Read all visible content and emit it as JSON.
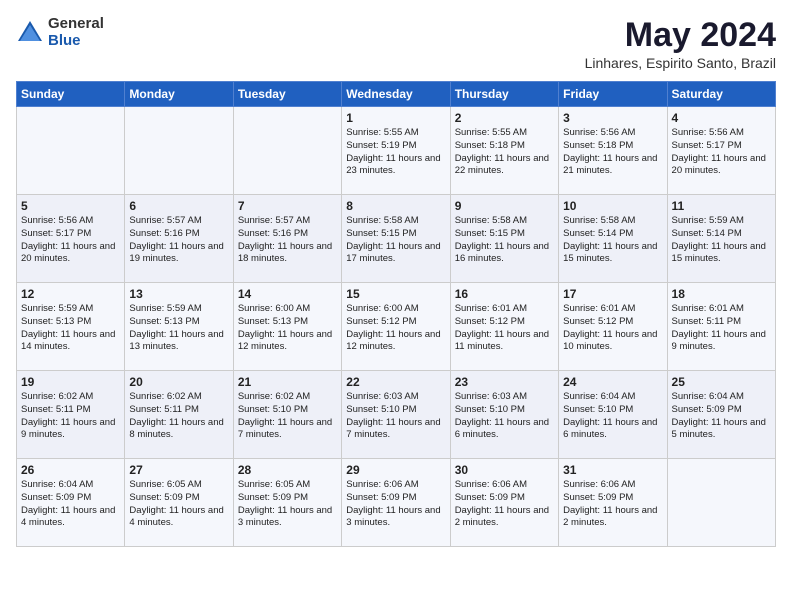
{
  "logo": {
    "general": "General",
    "blue": "Blue"
  },
  "title": "May 2024",
  "subtitle": "Linhares, Espirito Santo, Brazil",
  "days_of_week": [
    "Sunday",
    "Monday",
    "Tuesday",
    "Wednesday",
    "Thursday",
    "Friday",
    "Saturday"
  ],
  "weeks": [
    [
      {
        "day": "",
        "sunrise": "",
        "sunset": "",
        "daylight": ""
      },
      {
        "day": "",
        "sunrise": "",
        "sunset": "",
        "daylight": ""
      },
      {
        "day": "",
        "sunrise": "",
        "sunset": "",
        "daylight": ""
      },
      {
        "day": "1",
        "sunrise": "Sunrise: 5:55 AM",
        "sunset": "Sunset: 5:19 PM",
        "daylight": "Daylight: 11 hours and 23 minutes."
      },
      {
        "day": "2",
        "sunrise": "Sunrise: 5:55 AM",
        "sunset": "Sunset: 5:18 PM",
        "daylight": "Daylight: 11 hours and 22 minutes."
      },
      {
        "day": "3",
        "sunrise": "Sunrise: 5:56 AM",
        "sunset": "Sunset: 5:18 PM",
        "daylight": "Daylight: 11 hours and 21 minutes."
      },
      {
        "day": "4",
        "sunrise": "Sunrise: 5:56 AM",
        "sunset": "Sunset: 5:17 PM",
        "daylight": "Daylight: 11 hours and 20 minutes."
      }
    ],
    [
      {
        "day": "5",
        "sunrise": "Sunrise: 5:56 AM",
        "sunset": "Sunset: 5:17 PM",
        "daylight": "Daylight: 11 hours and 20 minutes."
      },
      {
        "day": "6",
        "sunrise": "Sunrise: 5:57 AM",
        "sunset": "Sunset: 5:16 PM",
        "daylight": "Daylight: 11 hours and 19 minutes."
      },
      {
        "day": "7",
        "sunrise": "Sunrise: 5:57 AM",
        "sunset": "Sunset: 5:16 PM",
        "daylight": "Daylight: 11 hours and 18 minutes."
      },
      {
        "day": "8",
        "sunrise": "Sunrise: 5:58 AM",
        "sunset": "Sunset: 5:15 PM",
        "daylight": "Daylight: 11 hours and 17 minutes."
      },
      {
        "day": "9",
        "sunrise": "Sunrise: 5:58 AM",
        "sunset": "Sunset: 5:15 PM",
        "daylight": "Daylight: 11 hours and 16 minutes."
      },
      {
        "day": "10",
        "sunrise": "Sunrise: 5:58 AM",
        "sunset": "Sunset: 5:14 PM",
        "daylight": "Daylight: 11 hours and 15 minutes."
      },
      {
        "day": "11",
        "sunrise": "Sunrise: 5:59 AM",
        "sunset": "Sunset: 5:14 PM",
        "daylight": "Daylight: 11 hours and 15 minutes."
      }
    ],
    [
      {
        "day": "12",
        "sunrise": "Sunrise: 5:59 AM",
        "sunset": "Sunset: 5:13 PM",
        "daylight": "Daylight: 11 hours and 14 minutes."
      },
      {
        "day": "13",
        "sunrise": "Sunrise: 5:59 AM",
        "sunset": "Sunset: 5:13 PM",
        "daylight": "Daylight: 11 hours and 13 minutes."
      },
      {
        "day": "14",
        "sunrise": "Sunrise: 6:00 AM",
        "sunset": "Sunset: 5:13 PM",
        "daylight": "Daylight: 11 hours and 12 minutes."
      },
      {
        "day": "15",
        "sunrise": "Sunrise: 6:00 AM",
        "sunset": "Sunset: 5:12 PM",
        "daylight": "Daylight: 11 hours and 12 minutes."
      },
      {
        "day": "16",
        "sunrise": "Sunrise: 6:01 AM",
        "sunset": "Sunset: 5:12 PM",
        "daylight": "Daylight: 11 hours and 11 minutes."
      },
      {
        "day": "17",
        "sunrise": "Sunrise: 6:01 AM",
        "sunset": "Sunset: 5:12 PM",
        "daylight": "Daylight: 11 hours and 10 minutes."
      },
      {
        "day": "18",
        "sunrise": "Sunrise: 6:01 AM",
        "sunset": "Sunset: 5:11 PM",
        "daylight": "Daylight: 11 hours and 9 minutes."
      }
    ],
    [
      {
        "day": "19",
        "sunrise": "Sunrise: 6:02 AM",
        "sunset": "Sunset: 5:11 PM",
        "daylight": "Daylight: 11 hours and 9 minutes."
      },
      {
        "day": "20",
        "sunrise": "Sunrise: 6:02 AM",
        "sunset": "Sunset: 5:11 PM",
        "daylight": "Daylight: 11 hours and 8 minutes."
      },
      {
        "day": "21",
        "sunrise": "Sunrise: 6:02 AM",
        "sunset": "Sunset: 5:10 PM",
        "daylight": "Daylight: 11 hours and 7 minutes."
      },
      {
        "day": "22",
        "sunrise": "Sunrise: 6:03 AM",
        "sunset": "Sunset: 5:10 PM",
        "daylight": "Daylight: 11 hours and 7 minutes."
      },
      {
        "day": "23",
        "sunrise": "Sunrise: 6:03 AM",
        "sunset": "Sunset: 5:10 PM",
        "daylight": "Daylight: 11 hours and 6 minutes."
      },
      {
        "day": "24",
        "sunrise": "Sunrise: 6:04 AM",
        "sunset": "Sunset: 5:10 PM",
        "daylight": "Daylight: 11 hours and 6 minutes."
      },
      {
        "day": "25",
        "sunrise": "Sunrise: 6:04 AM",
        "sunset": "Sunset: 5:09 PM",
        "daylight": "Daylight: 11 hours and 5 minutes."
      }
    ],
    [
      {
        "day": "26",
        "sunrise": "Sunrise: 6:04 AM",
        "sunset": "Sunset: 5:09 PM",
        "daylight": "Daylight: 11 hours and 4 minutes."
      },
      {
        "day": "27",
        "sunrise": "Sunrise: 6:05 AM",
        "sunset": "Sunset: 5:09 PM",
        "daylight": "Daylight: 11 hours and 4 minutes."
      },
      {
        "day": "28",
        "sunrise": "Sunrise: 6:05 AM",
        "sunset": "Sunset: 5:09 PM",
        "daylight": "Daylight: 11 hours and 3 minutes."
      },
      {
        "day": "29",
        "sunrise": "Sunrise: 6:06 AM",
        "sunset": "Sunset: 5:09 PM",
        "daylight": "Daylight: 11 hours and 3 minutes."
      },
      {
        "day": "30",
        "sunrise": "Sunrise: 6:06 AM",
        "sunset": "Sunset: 5:09 PM",
        "daylight": "Daylight: 11 hours and 2 minutes."
      },
      {
        "day": "31",
        "sunrise": "Sunrise: 6:06 AM",
        "sunset": "Sunset: 5:09 PM",
        "daylight": "Daylight: 11 hours and 2 minutes."
      },
      {
        "day": "",
        "sunrise": "",
        "sunset": "",
        "daylight": ""
      }
    ]
  ]
}
